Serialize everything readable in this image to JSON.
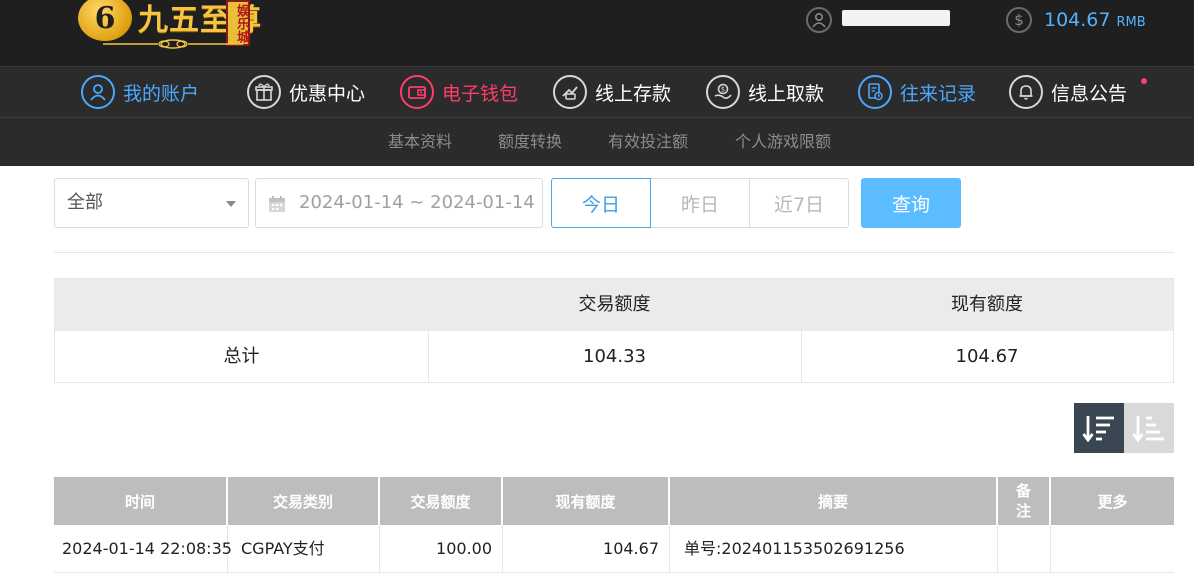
{
  "header": {
    "logo_text": "九五至尊",
    "logo_seal": "娱乐城",
    "logo_badge": "6",
    "balance": "104.67",
    "currency": "RMB"
  },
  "main_nav": [
    {
      "label": "我的账户",
      "icon": "user-icon",
      "state": "active"
    },
    {
      "label": "优惠中心",
      "icon": "gift-icon",
      "state": "normal"
    },
    {
      "label": "电子钱包",
      "icon": "wallet-icon",
      "state": "highlight"
    },
    {
      "label": "线上存款",
      "icon": "deposit-icon",
      "state": "normal"
    },
    {
      "label": "线上取款",
      "icon": "withdraw-icon",
      "state": "normal"
    },
    {
      "label": "往来记录",
      "icon": "records-icon",
      "state": "active"
    },
    {
      "label": "信息公告",
      "icon": "bell-icon",
      "state": "normal"
    }
  ],
  "sub_nav": [
    "基本资料",
    "额度转换",
    "有效投注额",
    "个人游戏限额"
  ],
  "filters": {
    "type_value": "全部",
    "date_range": "2024-01-14 ~ 2024-01-14",
    "quick": [
      "今日",
      "昨日",
      "近7日"
    ],
    "query_label": "查询"
  },
  "summary": {
    "headers": [
      "",
      "交易额度",
      "现有额度"
    ],
    "row_label": "总计",
    "trade_amount": "104.33",
    "current_amount": "104.67"
  },
  "table": {
    "headers": [
      "时间",
      "交易类别",
      "交易额度",
      "现有额度",
      "摘要",
      "备注",
      "更多"
    ],
    "rows": [
      {
        "time": "2024-01-14 22:08:35",
        "type": "CGPAY支付",
        "amount": "100.00",
        "balance": "104.67",
        "summary": "单号:202401153502691256",
        "note": "",
        "more": ""
      }
    ]
  },
  "colors": {
    "accent_blue": "#4aa8ff",
    "accent_red": "#ff3d6a",
    "query_button": "#5bbcff",
    "gold": "#f5c542"
  }
}
